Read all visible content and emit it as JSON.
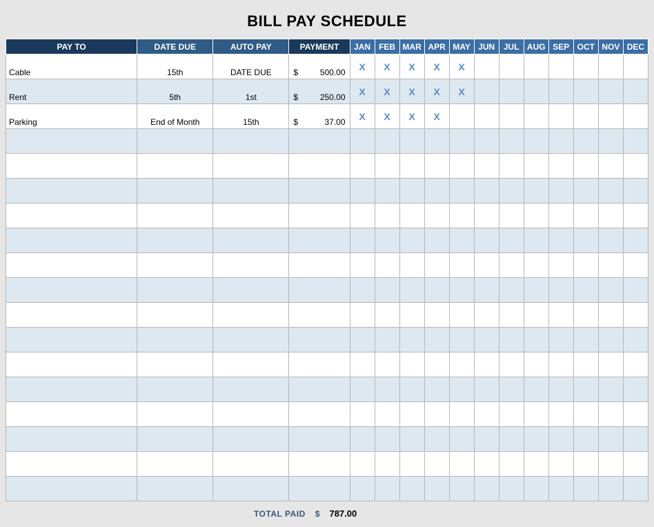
{
  "title": "BILL PAY SCHEDULE",
  "headers": {
    "payto": "PAY TO",
    "date_due": "DATE DUE",
    "auto_pay": "AUTO PAY",
    "payment": "PAYMENT"
  },
  "currency_symbol": "$",
  "months": [
    "JAN",
    "FEB",
    "MAR",
    "APR",
    "MAY",
    "JUN",
    "JUL",
    "AUG",
    "SEP",
    "OCT",
    "NOV",
    "DEC"
  ],
  "mark": "X",
  "rows": [
    {
      "payto": "Cable",
      "date_due": "15th",
      "auto_pay": "DATE DUE",
      "payment": "500.00",
      "marks": [
        true,
        true,
        true,
        true,
        true,
        false,
        false,
        false,
        false,
        false,
        false,
        false
      ]
    },
    {
      "payto": "Rent",
      "date_due": "5th",
      "auto_pay": "1st",
      "payment": "250.00",
      "marks": [
        true,
        true,
        true,
        true,
        true,
        false,
        false,
        false,
        false,
        false,
        false,
        false
      ]
    },
    {
      "payto": "Parking",
      "date_due": "End of Month",
      "auto_pay": "15th",
      "payment": "37.00",
      "marks": [
        true,
        true,
        true,
        true,
        false,
        false,
        false,
        false,
        false,
        false,
        false,
        false
      ]
    },
    {
      "payto": "",
      "date_due": "",
      "auto_pay": "",
      "payment": "",
      "marks": [
        false,
        false,
        false,
        false,
        false,
        false,
        false,
        false,
        false,
        false,
        false,
        false
      ]
    },
    {
      "payto": "",
      "date_due": "",
      "auto_pay": "",
      "payment": "",
      "marks": [
        false,
        false,
        false,
        false,
        false,
        false,
        false,
        false,
        false,
        false,
        false,
        false
      ]
    },
    {
      "payto": "",
      "date_due": "",
      "auto_pay": "",
      "payment": "",
      "marks": [
        false,
        false,
        false,
        false,
        false,
        false,
        false,
        false,
        false,
        false,
        false,
        false
      ]
    },
    {
      "payto": "",
      "date_due": "",
      "auto_pay": "",
      "payment": "",
      "marks": [
        false,
        false,
        false,
        false,
        false,
        false,
        false,
        false,
        false,
        false,
        false,
        false
      ]
    },
    {
      "payto": "",
      "date_due": "",
      "auto_pay": "",
      "payment": "",
      "marks": [
        false,
        false,
        false,
        false,
        false,
        false,
        false,
        false,
        false,
        false,
        false,
        false
      ]
    },
    {
      "payto": "",
      "date_due": "",
      "auto_pay": "",
      "payment": "",
      "marks": [
        false,
        false,
        false,
        false,
        false,
        false,
        false,
        false,
        false,
        false,
        false,
        false
      ]
    },
    {
      "payto": "",
      "date_due": "",
      "auto_pay": "",
      "payment": "",
      "marks": [
        false,
        false,
        false,
        false,
        false,
        false,
        false,
        false,
        false,
        false,
        false,
        false
      ]
    },
    {
      "payto": "",
      "date_due": "",
      "auto_pay": "",
      "payment": "",
      "marks": [
        false,
        false,
        false,
        false,
        false,
        false,
        false,
        false,
        false,
        false,
        false,
        false
      ]
    },
    {
      "payto": "",
      "date_due": "",
      "auto_pay": "",
      "payment": "",
      "marks": [
        false,
        false,
        false,
        false,
        false,
        false,
        false,
        false,
        false,
        false,
        false,
        false
      ]
    },
    {
      "payto": "",
      "date_due": "",
      "auto_pay": "",
      "payment": "",
      "marks": [
        false,
        false,
        false,
        false,
        false,
        false,
        false,
        false,
        false,
        false,
        false,
        false
      ]
    },
    {
      "payto": "",
      "date_due": "",
      "auto_pay": "",
      "payment": "",
      "marks": [
        false,
        false,
        false,
        false,
        false,
        false,
        false,
        false,
        false,
        false,
        false,
        false
      ]
    },
    {
      "payto": "",
      "date_due": "",
      "auto_pay": "",
      "payment": "",
      "marks": [
        false,
        false,
        false,
        false,
        false,
        false,
        false,
        false,
        false,
        false,
        false,
        false
      ]
    },
    {
      "payto": "",
      "date_due": "",
      "auto_pay": "",
      "payment": "",
      "marks": [
        false,
        false,
        false,
        false,
        false,
        false,
        false,
        false,
        false,
        false,
        false,
        false
      ]
    },
    {
      "payto": "",
      "date_due": "",
      "auto_pay": "",
      "payment": "",
      "marks": [
        false,
        false,
        false,
        false,
        false,
        false,
        false,
        false,
        false,
        false,
        false,
        false
      ]
    },
    {
      "payto": "",
      "date_due": "",
      "auto_pay": "",
      "payment": "",
      "marks": [
        false,
        false,
        false,
        false,
        false,
        false,
        false,
        false,
        false,
        false,
        false,
        false
      ]
    }
  ],
  "footer": {
    "label": "TOTAL PAID",
    "amount": "787.00"
  }
}
